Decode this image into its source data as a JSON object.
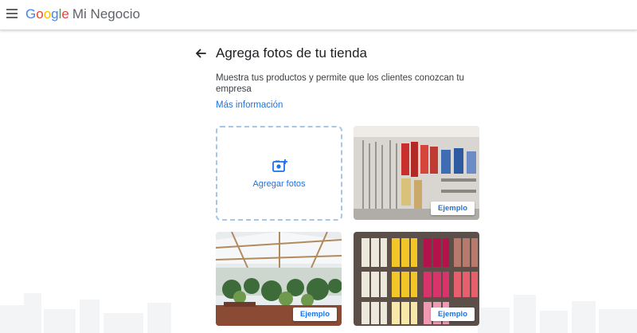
{
  "header": {
    "brand_letters": [
      "G",
      "o",
      "o",
      "g",
      "l",
      "e"
    ],
    "product": "Mi Negocio"
  },
  "page": {
    "title": "Agrega fotos de tu tienda",
    "description": "Muestra tus productos y permite que los clientes conozcan tu empresa",
    "more_info": "Más información"
  },
  "tiles": {
    "add_label": "Agregar fotos",
    "example_label": "Ejemplo"
  },
  "colors": {
    "accent": "#1a73e8",
    "dashed_border": "#a8c7e8"
  },
  "icons": [
    "menu-icon",
    "back-arrow-icon",
    "add-photo-icon"
  ]
}
